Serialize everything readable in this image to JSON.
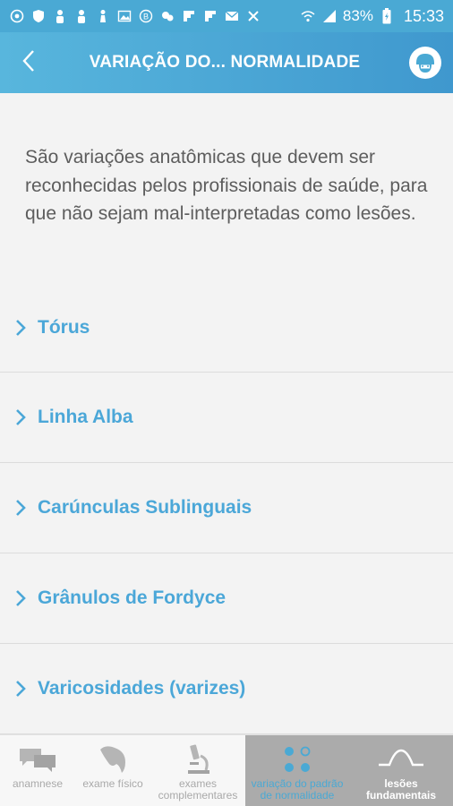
{
  "status_bar": {
    "battery": "83%",
    "time": "15:33",
    "icons": [
      "whatsapp-icon",
      "shield-icon",
      "person-icon",
      "person-icon",
      "chess-icon",
      "image-icon",
      "bitcoin-icon",
      "weather-icon",
      "flipboard-icon",
      "flipboard-icon",
      "mail-icon",
      "close-icon",
      "wifi-icon",
      "signal-icon",
      "battery-icon"
    ]
  },
  "app_bar": {
    "title": "VARIAÇÃO DO... NORMALIDADE",
    "back_icon": "chevron-left-icon",
    "avatar_icon": "dentist-avatar-icon"
  },
  "intro_text": "São variações anatômicas que devem ser reconhecidas pelos profissionais de saúde, para que não sejam mal-interpretadas como lesões.",
  "items": [
    {
      "label": "Tórus"
    },
    {
      "label": "Linha Alba"
    },
    {
      "label": "Carúnculas Sublinguais"
    },
    {
      "label": "Grânulos de Fordyce"
    },
    {
      "label": "Varicosidades (varizes)"
    }
  ],
  "tabs": [
    {
      "label": "anamnese",
      "icon": "chat-bubbles-icon"
    },
    {
      "label": "exame físico",
      "icon": "tooth-icon"
    },
    {
      "label": "exames complementares",
      "icon": "microscope-icon"
    },
    {
      "label": "variação do padrão de normalidade",
      "icon": "dots-grid-icon",
      "active": true
    },
    {
      "label": "lesões fundamentais",
      "icon": "lesion-curve-icon"
    }
  ],
  "colors": {
    "accent": "#4aa9d4",
    "status_bar": "#4aa9d4",
    "text_muted": "#5d5d5d",
    "item_label": "#4ba7d8",
    "tab_active_bg": "#ababab"
  }
}
